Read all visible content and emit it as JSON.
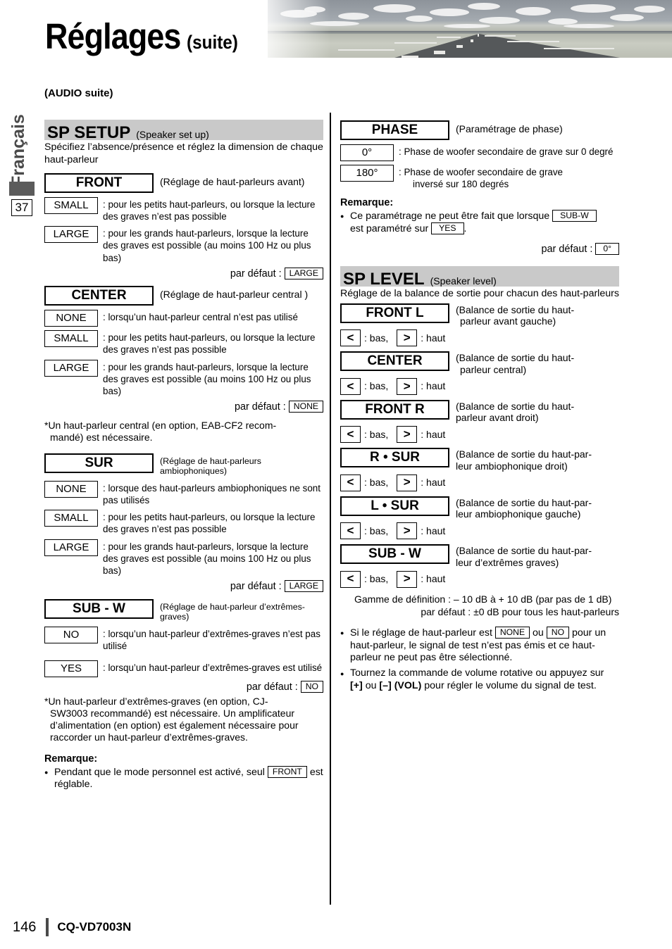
{
  "header": {
    "title_main": "Réglages",
    "title_suffix": "(suite)"
  },
  "sidebar": {
    "language": "Français",
    "chapter_number": "37"
  },
  "kicker": "(AUDIO suite)",
  "left_column": {
    "section": {
      "name": "SP SETUP",
      "name_translation": "(Speaker set up)",
      "description": "Spécifiez l’absence/présence et réglez la dimension de chaque haut-parleur"
    },
    "groups": [
      {
        "label": "FRONT",
        "caption": "(Réglage de haut-parleurs avant)",
        "options": [
          {
            "value": "SMALL",
            "text": "pour les petits haut-parleurs, ou lorsque la lecture des graves n’est pas possible"
          },
          {
            "value": "LARGE",
            "text": "pour les grands haut-parleurs, lorsque la lecture des graves est possible (au moins 100 Hz ou plus bas)"
          }
        ],
        "default_label": "par défaut :",
        "default_value": "LARGE",
        "footnote": ""
      },
      {
        "label": "CENTER",
        "caption": "(Réglage de haut-parleur central )",
        "options": [
          {
            "value": "NONE",
            "text": "lorsqu’un haut-parleur central n’est pas utilisé"
          },
          {
            "value": "SMALL",
            "text": "pour les petits haut-parleurs, ou lorsque la lecture des graves n’est pas possible"
          },
          {
            "value": "LARGE",
            "text": "pour les grands haut-parleurs, lorsque la lecture des graves est possible (au moins 100 Hz ou plus bas)"
          }
        ],
        "default_label": "par défaut :",
        "default_value": "NONE",
        "footnote_line1": "*Un haut-parleur central (en option, EAB-CF2 recom-",
        "footnote_line2": "mandé) est nécessaire."
      },
      {
        "label": "SUR",
        "caption": "(Réglage de haut-parleurs ambiophoniques)",
        "options": [
          {
            "value": "NONE",
            "text": "lorsque des haut-parleurs ambiophoniques ne sont pas utilisés"
          },
          {
            "value": "SMALL",
            "text": "pour les petits haut-parleurs, ou lorsque la lecture des graves n’est pas possible"
          },
          {
            "value": "LARGE",
            "text": "pour les grands haut-parleurs, lorsque la lecture des graves est possible (au moins 100 Hz ou plus bas)"
          }
        ],
        "default_label": "par défaut :",
        "default_value": "LARGE",
        "footnote": ""
      },
      {
        "label": "SUB - W",
        "caption": "(Réglage de haut-parleur d’extrêmes-graves)",
        "options": [
          {
            "value": "NO",
            "text": "lorsqu’un haut-parleur d’extrêmes-graves n’est pas utilisé"
          },
          {
            "value": "YES",
            "text": "lorsqu’un haut-parleur d’extrêmes-graves est utilisé"
          }
        ],
        "default_label": "par défaut :",
        "default_value": "NO",
        "footnote_line1": "*Un haut-parleur d’extrêmes-graves (en option, CJ-",
        "footnote_line2": "SW3003 recommandé) est nécessaire. Un amplificateur",
        "footnote_line3": "d’alimentation (en option) est également nécessaire pour",
        "footnote_line4": "raccorder un haut-parleur d’extrêmes-graves."
      }
    ],
    "remarque": {
      "heading": "Remarque:",
      "bullet_pre": "Pendant que le mode personnel est activé, seul",
      "bullet_tag": "FRONT",
      "bullet_post": "est réglable."
    }
  },
  "right_column": {
    "phase": {
      "label": "PHASE",
      "caption": "(Paramétrage de phase)",
      "options": [
        {
          "value": "0°",
          "text": "Phase de woofer secondaire de grave sur 0 degré"
        },
        {
          "value": "180°",
          "text_line1": "Phase de woofer secondaire de grave",
          "text_line2": "inversé sur 180 degrés"
        }
      ],
      "remarque_heading": "Remarque:",
      "remarque_pre": "Ce paramétrage ne peut être fait que lorsque",
      "remarque_tag1": "SUB-W",
      "remarque_mid": "est paramétré sur",
      "remarque_tag2": "YES",
      "remarque_post": ".",
      "default_label": "par défaut :",
      "default_value": "0°"
    },
    "sp_level": {
      "name": "SP LEVEL",
      "name_translation": "(Speaker level)",
      "description": "Réglage de la balance de sortie pour chacun des haut-parleurs",
      "arrow_low_key": "<",
      "arrow_low_label": ": bas,",
      "arrow_high_key": ">",
      "arrow_high_label": ": haut",
      "items": [
        {
          "label": "FRONT L",
          "caption_line1": "(Balance de sortie du haut-",
          "caption_line2": "parleur avant gauche)"
        },
        {
          "label": "CENTER",
          "caption_line1": "(Balance de sortie du haut-",
          "caption_line2": "parleur central)"
        },
        {
          "label": "FRONT R",
          "caption_line1": "(Balance de sortie du haut-",
          "caption_line2": "parleur avant droit)"
        },
        {
          "label": "R • SUR",
          "caption_line1": "(Balance de sortie du haut-par-",
          "caption_line2": "leur ambiophonique droit)"
        },
        {
          "label": "L • SUR",
          "caption_line1": "(Balance de sortie du haut-par-",
          "caption_line2": "leur ambiophonique gauche)"
        },
        {
          "label": "SUB - W",
          "caption_line1": "(Balance de sortie du haut-par-",
          "caption_line2": "leur d’extrêmes graves)"
        }
      ],
      "range_line1": "Gamme de définition : – 10 dB à + 10 dB (par pas de 1 dB)",
      "range_line2": "par défaut : ±0 dB pour tous les haut-parleurs",
      "notes": {
        "bullet1_pre": "Si le réglage de haut-parleur est",
        "bullet1_tag1": "NONE",
        "bullet1_mid": "ou",
        "bullet1_tag2": "NO",
        "bullet1_post": "pour un haut-parleur, le signal de test n’est pas émis et ce haut-parleur ne peut pas être sélectionné.",
        "bullet2_pre": "Tournez la commande de volume rotative ou appuyez sur",
        "bullet2_key1": "[+]",
        "bullet2_mid": "ou",
        "bullet2_key2": "[–] (VOL)",
        "bullet2_post": "pour régler le volume du signal de test."
      }
    }
  },
  "footer": {
    "page_number": "146",
    "model": "CQ-VD7003N"
  }
}
